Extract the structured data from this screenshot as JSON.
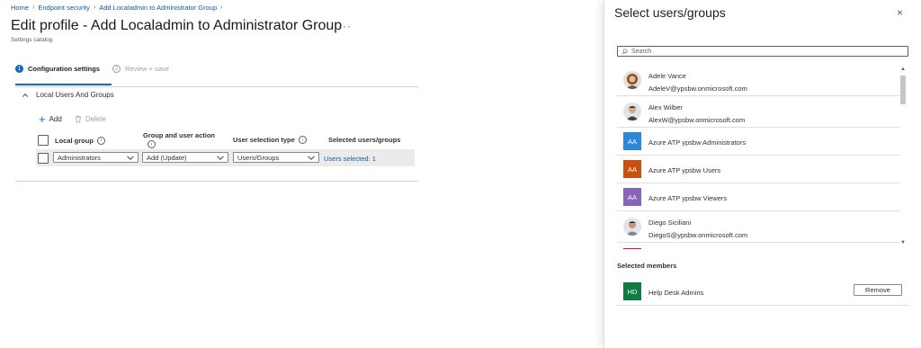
{
  "breadcrumb": [
    "Home",
    "Endpoint security",
    "Add Localadmin to Administrator Group"
  ],
  "page": {
    "title": "Edit profile - Add Localadmin to Administrator Group",
    "more": "···",
    "subtitle": "Settings catalog"
  },
  "steps": [
    {
      "number": "1",
      "label": "Configuration settings",
      "active": true
    },
    {
      "number": "2",
      "label": "Review + save",
      "active": false
    }
  ],
  "section": {
    "title": "Local Users And Groups"
  },
  "commands": {
    "add": "Add",
    "delete": "Delete"
  },
  "table": {
    "headers": {
      "local_group": "Local group",
      "group_action": "Group and user action",
      "selection_type": "User selection type",
      "selected": "Selected users/groups"
    },
    "row": {
      "local_group": "Administrators",
      "group_action": "Add (Update)",
      "selection_type": "Users/Groups",
      "selected": "Users selected: 1"
    }
  },
  "panel": {
    "title": "Select users/groups",
    "close": "×",
    "search_placeholder": "Search",
    "items": [
      {
        "name": "Adele Vance",
        "email": "AdeleV@ypsbw.onmicrosoft.com",
        "kind": "user"
      },
      {
        "name": "Alex Wilber",
        "email": "AlexW@ypsbw.onmicrosoft.com",
        "kind": "user"
      },
      {
        "name": "Azure ATP ypsbw Administrators",
        "initials": "AA",
        "color": "#2b88d8",
        "kind": "group"
      },
      {
        "name": "Azure ATP ypsbw Users",
        "initials": "AA",
        "color": "#ca5010",
        "kind": "group"
      },
      {
        "name": "Azure ATP ypsbw Viewers",
        "initials": "AA",
        "color": "#8764b8",
        "kind": "group"
      },
      {
        "name": "Diego Siciliani",
        "email": "DiegoS@ypsbw.onmicrosoft.com",
        "kind": "user"
      }
    ],
    "selected_title": "Selected members",
    "selected": {
      "name": "Help Desk Admins",
      "initials": "HD",
      "color": "#107c41"
    },
    "remove": "Remove"
  },
  "colors": {
    "accent": "#0f6cbd",
    "link": "#0f5cad"
  }
}
